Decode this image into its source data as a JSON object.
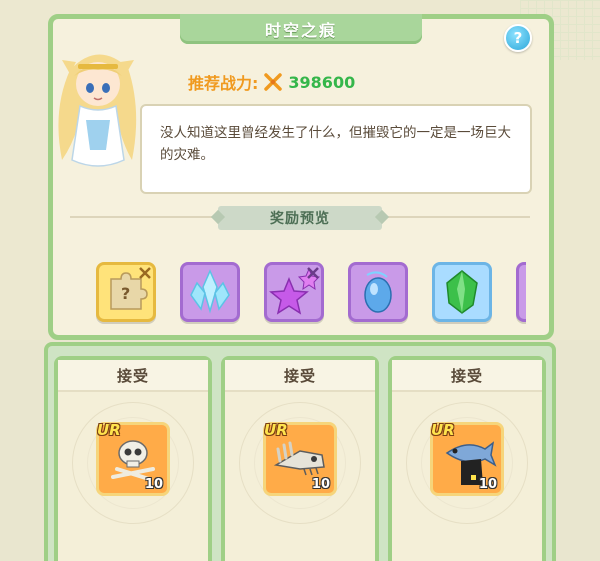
{
  "header": {
    "title": "时空之痕",
    "help_icon_text": "?"
  },
  "stage": {
    "power_label": "推荐战力:",
    "power_value": "398600",
    "description": "没人知道这里曾经发生了什么，但摧毁它的一定是一场巨大的灾难。"
  },
  "rewards": {
    "title": "奖励预览",
    "items": [
      {
        "icon": "mystery-puzzle-icon",
        "glyph": "?"
      },
      {
        "icon": "ice-crystal-icon"
      },
      {
        "icon": "purple-star-icon"
      },
      {
        "icon": "blue-gem-icon"
      },
      {
        "icon": "green-gem-icon"
      },
      {
        "icon": "purple-item-icon"
      }
    ]
  },
  "tasks": [
    {
      "button": "接受",
      "badge": "UR",
      "count": "10",
      "icon": "skull-bones-icon"
    },
    {
      "button": "接受",
      "badge": "UR",
      "count": "10",
      "icon": "bone-dragon-icon"
    },
    {
      "button": "接受",
      "badge": "UR",
      "count": "10",
      "icon": "fish-cloak-icon"
    }
  ],
  "colors": {
    "frame_green": "#9fcf86",
    "power_label": "#f09a1f",
    "power_value": "#35b64a",
    "card_orange": "#ffab48"
  }
}
